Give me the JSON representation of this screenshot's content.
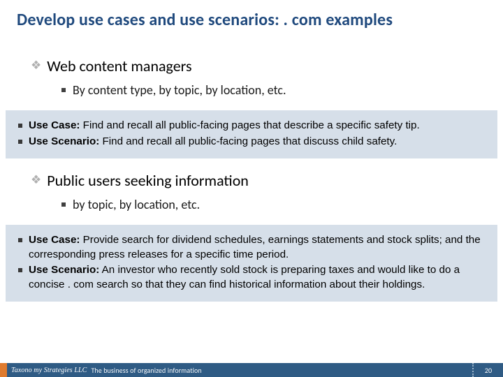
{
  "title": "Develop use cases and use scenarios: . com examples",
  "group1": {
    "heading": "Web content managers",
    "sub": "By content type, by topic, by location, etc."
  },
  "box1": {
    "uc_label": "Use Case:",
    "uc_text": " Find and recall all public-facing pages that describe a specific safety tip.",
    "us_label": "Use Scenario:",
    "us_text": " Find and recall all public-facing pages that discuss child safety."
  },
  "group2": {
    "heading": "Public users seeking information",
    "sub": "by topic, by location, etc."
  },
  "box2": {
    "uc_label": "Use Case:",
    "uc_text": " Provide search for dividend schedules, earnings statements and stock splits; and the corresponding press releases for a specific time period.",
    "us_label": "Use Scenario:",
    "us_text": " An investor who recently sold stock is preparing taxes and would like to do a concise . com search so that they can find historical information about their holdings."
  },
  "footer": {
    "company": "Taxono my Strategies LLC",
    "tagline": "The business of organized information",
    "page": "20"
  }
}
